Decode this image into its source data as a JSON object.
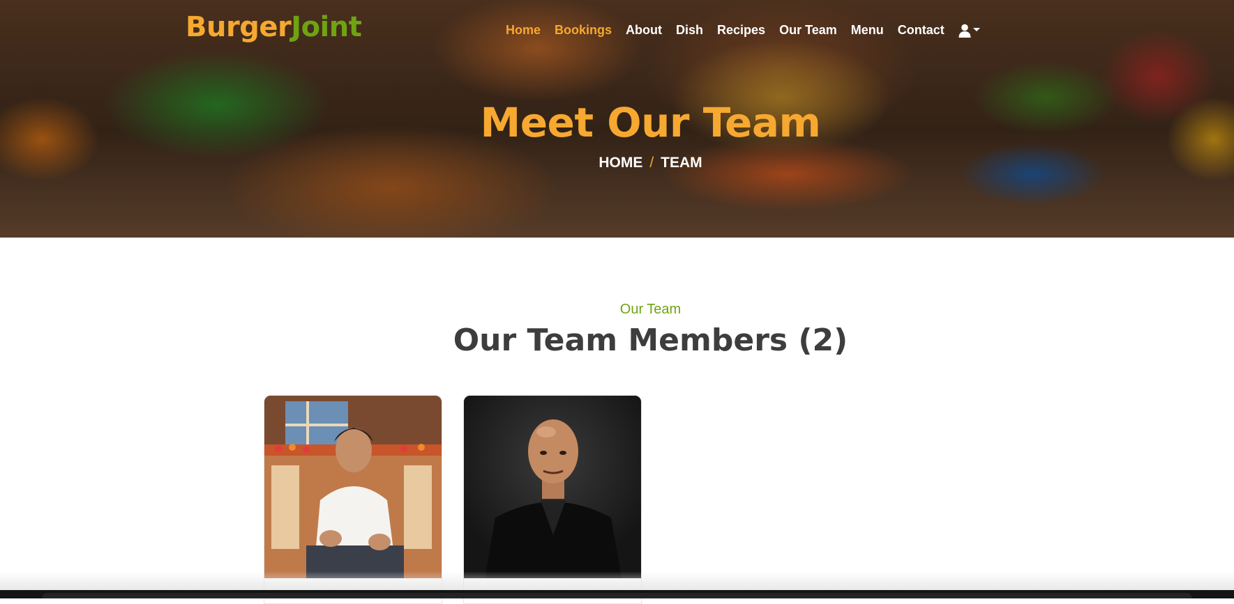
{
  "brand": {
    "part1": "Burger",
    "part2": "Joint",
    "color1": "#f6a830",
    "color2": "#6fa312"
  },
  "nav": {
    "items": [
      {
        "label": "Home",
        "active": true
      },
      {
        "label": "Bookings",
        "active": true
      },
      {
        "label": "About",
        "active": false
      },
      {
        "label": "Dish",
        "active": false
      },
      {
        "label": "Recipes",
        "active": false
      },
      {
        "label": "Our Team",
        "active": false
      },
      {
        "label": "Menu",
        "active": false
      },
      {
        "label": "Contact",
        "active": false
      }
    ],
    "user_icon": "user-icon",
    "caret_icon": "caret-down-icon"
  },
  "hero": {
    "title": "Meet Our Team",
    "breadcrumb": {
      "home": "HOME",
      "separator": "/",
      "current": "TEAM"
    }
  },
  "section": {
    "subtitle": "Our Team",
    "heading": "Our Team Members (2)"
  },
  "colors": {
    "accent": "#f6a830",
    "green": "#6fa312",
    "heading": "#3d3d3d"
  }
}
